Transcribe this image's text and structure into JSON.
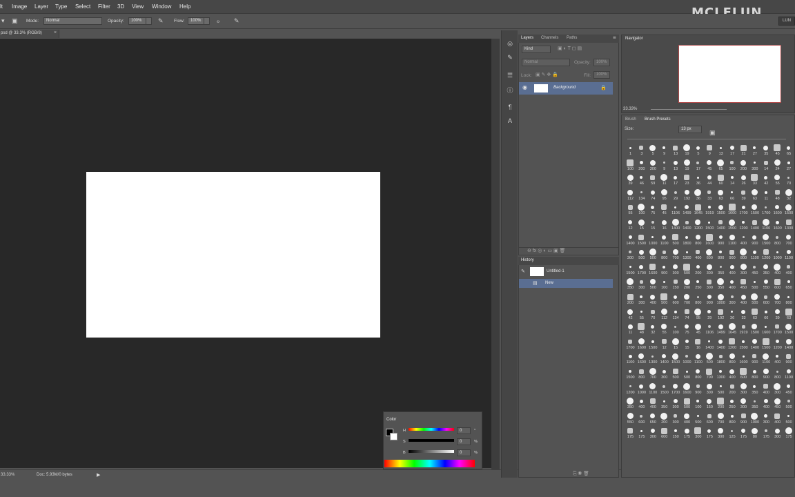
{
  "menu": [
    "lt",
    "Image",
    "Layer",
    "Type",
    "Select",
    "Filter",
    "3D",
    "View",
    "Window",
    "Help"
  ],
  "brand": "MCLELUN",
  "workspace_button": "LUN",
  "options": {
    "mode_label": "Mode:",
    "mode_value": "Normal",
    "opacity_label": "Opacity:",
    "opacity_value": "100%",
    "flow_label": "Flow:",
    "flow_value": "100%"
  },
  "document_tab": "psd @ 33.3% (RGB/8)",
  "status": {
    "doc": "Doc: 5.93M/0 bytes"
  },
  "layers_panel": {
    "tabs": [
      "Layers",
      "Channels",
      "Paths"
    ],
    "kind": "Kind",
    "blend": "Normal",
    "opacity_label": "Opacity:",
    "opacity_value": "100%",
    "lock_label": "Lock:",
    "fill_label": "Fill:",
    "fill_value": "100%",
    "layer_name": "Background"
  },
  "history_panel": {
    "title": "History",
    "items": [
      "Untitled-1",
      "New"
    ]
  },
  "navigator_panel": {
    "title": "Navigator",
    "zoom": "33.33%"
  },
  "brush_panel": {
    "tabs": [
      "Brush",
      "Brush Presets"
    ],
    "size_label": "Size:",
    "size_value": "13 px",
    "rows": [
      [
        "1",
        "3",
        "5",
        "9",
        "13",
        "19",
        "5",
        "9",
        "13",
        "17",
        "21",
        "27",
        "35",
        "45",
        "65"
      ],
      [
        "100",
        "200",
        "300",
        "9",
        "13",
        "19",
        "17",
        "45",
        "65",
        "100",
        "200",
        "300",
        "14",
        "24",
        "27"
      ],
      [
        "39",
        "46",
        "59",
        "11",
        "17",
        "23",
        "36",
        "44",
        "60",
        "14",
        "26",
        "33",
        "42",
        "55",
        "70"
      ],
      [
        "112",
        "134",
        "74",
        "95",
        "29",
        "192",
        "36",
        "33",
        "63",
        "66",
        "39",
        "63",
        "11",
        "48",
        "32"
      ],
      [
        "55",
        "100",
        "75",
        "45",
        "1106",
        "1499",
        "1645",
        "1919",
        "1500",
        "1600",
        "1700",
        "1500",
        "1700",
        "1600",
        "1500"
      ],
      [
        "12",
        "15",
        "15",
        "16",
        "1400",
        "1400",
        "1200",
        "1500",
        "1400",
        "1500",
        "1200",
        "1400",
        "1100",
        "1600",
        "1300"
      ],
      [
        "1400",
        "1500",
        "1000",
        "1100",
        "500",
        "1800",
        "800",
        "1600",
        "900",
        "1100",
        "400",
        "900",
        "1500",
        "800",
        "700"
      ],
      [
        "300",
        "500",
        "500",
        "800",
        "700",
        "1300",
        "400",
        "600",
        "800",
        "900",
        "800",
        "1100",
        "1200",
        "1000",
        "1100"
      ],
      [
        "1500",
        "1700",
        "1600",
        "900",
        "300",
        "500",
        "200",
        "300",
        "350",
        "400",
        "300",
        "450",
        "350",
        "400",
        "400"
      ],
      [
        "350",
        "300",
        "500",
        "100",
        "150",
        "200",
        "250",
        "300",
        "350",
        "400",
        "450",
        "500",
        "550",
        "600",
        "650"
      ],
      [
        "200",
        "300",
        "400",
        "500",
        "600",
        "700",
        "800",
        "900",
        "1000",
        "300",
        "400",
        "500",
        "600",
        "700",
        "800"
      ],
      [
        "42",
        "55",
        "70",
        "112",
        "134",
        "74",
        "95",
        "29",
        "192",
        "36",
        "33",
        "63",
        "66",
        "39",
        "63"
      ],
      [
        "11",
        "48",
        "32",
        "55",
        "100",
        "75",
        "45",
        "1106",
        "1499",
        "1645",
        "1919",
        "1500",
        "1600",
        "1700",
        "1500"
      ],
      [
        "1700",
        "1600",
        "1500",
        "12",
        "15",
        "15",
        "16",
        "1400",
        "1400",
        "1200",
        "1500",
        "1400",
        "1500",
        "1200",
        "1400"
      ],
      [
        "1100",
        "1600",
        "1300",
        "1400",
        "1500",
        "1000",
        "1100",
        "500",
        "1800",
        "800",
        "1600",
        "900",
        "1100",
        "400",
        "900"
      ],
      [
        "1500",
        "800",
        "700",
        "300",
        "500",
        "500",
        "800",
        "700",
        "1300",
        "400",
        "600",
        "800",
        "900",
        "800",
        "1100"
      ],
      [
        "1200",
        "1000",
        "1100",
        "1500",
        "1700",
        "1600",
        "900",
        "300",
        "500",
        "200",
        "300",
        "350",
        "400",
        "300",
        "450"
      ],
      [
        "350",
        "400",
        "400",
        "350",
        "300",
        "500",
        "100",
        "150",
        "200",
        "250",
        "300",
        "350",
        "400",
        "450",
        "500"
      ],
      [
        "550",
        "600",
        "650",
        "200",
        "300",
        "400",
        "500",
        "600",
        "700",
        "800",
        "900",
        "1000",
        "300",
        "400",
        "500"
      ],
      [
        "175",
        "175",
        "300",
        "600",
        "150",
        "175",
        "300",
        "175",
        "300",
        "125",
        "175",
        "80",
        "175",
        "300",
        "175"
      ]
    ]
  },
  "color_panel": {
    "title": "Color",
    "h_label": "H",
    "s_label": "S",
    "b_label": "B",
    "h_value": "0",
    "s_value": "0",
    "b_value": "0",
    "deg": "°",
    "pct1": "%",
    "pct2": "%"
  }
}
